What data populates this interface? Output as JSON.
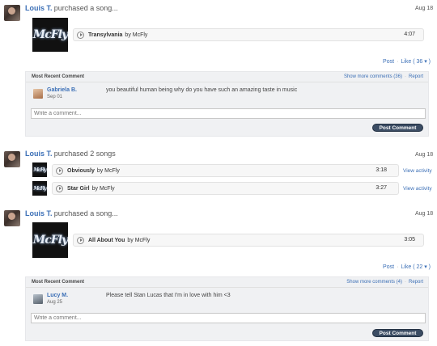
{
  "feed": [
    {
      "user": "Louis T.",
      "action": "purchased a song...",
      "date": "Aug 18",
      "tracks": [
        {
          "title": "Transylvania",
          "by": "by McFly",
          "duration": "4:07"
        }
      ],
      "post_label": "Post",
      "like_label": "Like",
      "like_count": "( 36 ▾ )",
      "comments": {
        "header": "Most Recent Comment",
        "show_more": "Show more comments (36)",
        "report": "Report",
        "author": "Gabriela B.",
        "date": "Sep 01",
        "text": "you beautiful human being why do you have such an amazing taste in music",
        "placeholder": "Write a comment...",
        "submit": "Post Comment"
      }
    },
    {
      "user": "Louis T.",
      "action": "purchased 2 songs",
      "date": "Aug 18",
      "tracks": [
        {
          "title": "Obviously",
          "by": "by McFly",
          "duration": "3:18",
          "activity": "View activity"
        },
        {
          "title": "Star Girl",
          "by": "by McFly",
          "duration": "3:27",
          "activity": "View activity"
        }
      ]
    },
    {
      "user": "Louis T.",
      "action": "purchased a song...",
      "date": "Aug 18",
      "tracks": [
        {
          "title": "All About You",
          "by": "by McFly",
          "duration": "3:05"
        }
      ],
      "post_label": "Post",
      "like_label": "Like",
      "like_count": "( 22 ▾ )",
      "comments": {
        "header": "Most Recent Comment",
        "show_more": "Show more comments (4)",
        "report": "Report",
        "author": "Lucy M.",
        "date": "Aug 25",
        "text": "Please tell Stan Lucas that I'm in love with him <3",
        "placeholder": "Write a comment...",
        "submit": "Post Comment"
      }
    }
  ],
  "album_logo": "McFly",
  "colors": {
    "link": "#3b6fb6",
    "button": "#3b4c63",
    "panel": "#f0f1f3"
  }
}
